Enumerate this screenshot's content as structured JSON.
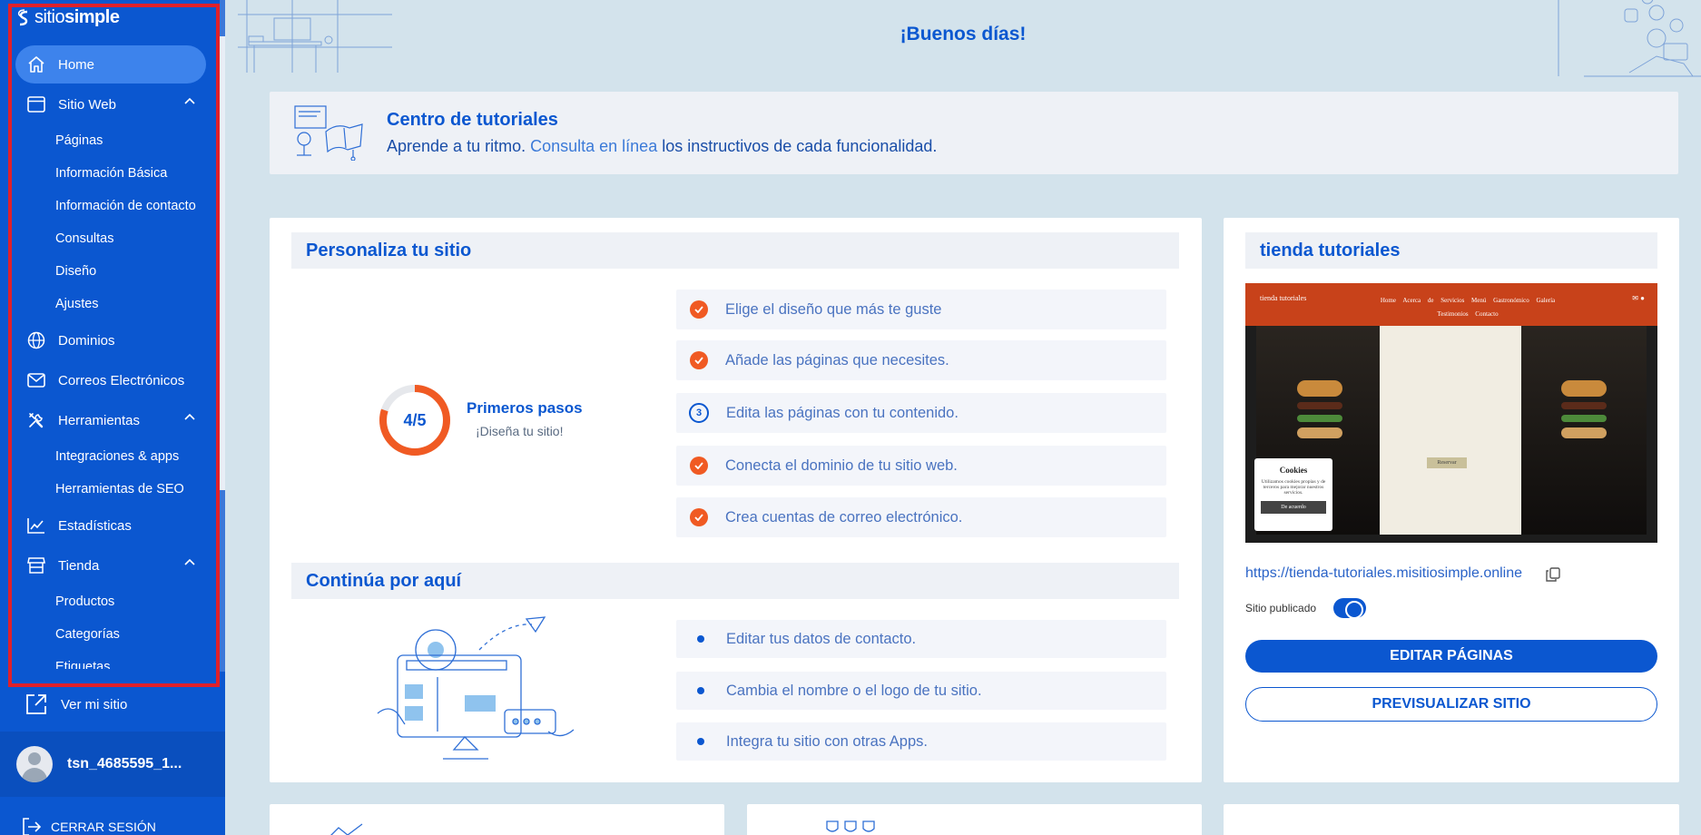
{
  "brand": {
    "name_light": "sitio",
    "name_bold": "simple"
  },
  "sidebar": {
    "items": [
      {
        "label": "Home",
        "icon": "home-icon"
      },
      {
        "label": "Sitio Web",
        "icon": "browser-window-icon"
      },
      {
        "label": "Dominios",
        "icon": "globe-icon"
      },
      {
        "label": "Correos Electrónicos",
        "icon": "mail-icon"
      },
      {
        "label": "Herramientas",
        "icon": "tools-icon"
      },
      {
        "label": "Estadísticas",
        "icon": "chart-line-icon"
      },
      {
        "label": "Tienda",
        "icon": "store-icon"
      }
    ],
    "sitio_web_sub": [
      "Páginas",
      "Información Básica",
      "Información de contacto",
      "Consultas",
      "Diseño",
      "Ajustes"
    ],
    "herramientas_sub": [
      "Integraciones & apps",
      "Herramientas de SEO"
    ],
    "tienda_sub": [
      "Productos",
      "Categorías",
      "Etiquetas"
    ],
    "ver_sitio": "Ver mi sitio",
    "user_name": "tsn_4685595_1...",
    "logout": "CERRAR SESIÓN"
  },
  "greeting": "¡Buenos días!",
  "tutorials": {
    "title": "Centro de tutoriales",
    "text_before": "Aprende a tu ritmo.",
    "link": "Consulta en línea",
    "text_after": "los instructivos de cada funcionalidad."
  },
  "personaliza": {
    "title": "Personaliza tu sitio",
    "progress": "4/5",
    "progress_fraction": 0.8,
    "progress_title": "Primeros pasos",
    "progress_sub": "¡Diseña tu sitio!",
    "steps": [
      {
        "label": "Elige el diseño que más te guste",
        "done": true
      },
      {
        "label": "Añade las páginas que necesites.",
        "done": true
      },
      {
        "label": "Edita las páginas con tu contenido.",
        "done": false,
        "number": "3"
      },
      {
        "label": "Conecta el dominio de tu sitio web.",
        "done": true
      },
      {
        "label": "Crea cuentas de correo electrónico.",
        "done": true
      }
    ]
  },
  "continua": {
    "title": "Continúa por aquí",
    "items": [
      "Editar tus datos de contacto.",
      "Cambia el nombre o el logo de tu sitio.",
      "Integra tu sitio con otras Apps."
    ]
  },
  "site": {
    "title": "tienda tutoriales",
    "preview": {
      "brand": "tienda tutoriales",
      "menu": "Home Acerca de Servicios Menú Gastronómico Galería Testimonios Contacto",
      "cookie_title": "Cookies",
      "cookie_text": "Utilizamos cookies propias y de terceros para mejorar nuestros servicios.",
      "cookie_button": "De acuerdo",
      "reserve": "Reservar"
    },
    "url": "https://tienda-tutoriales.misitiosimple.online",
    "published_label": "Sitio publicado",
    "published": true,
    "edit_button": "EDITAR PÁGINAS",
    "preview_button": "PREVISUALIZAR SITIO"
  },
  "colors": {
    "primary": "#0b57d0",
    "accent": "#f05a23",
    "background": "#d3e3ec",
    "highlight_border": "#e0202a"
  }
}
